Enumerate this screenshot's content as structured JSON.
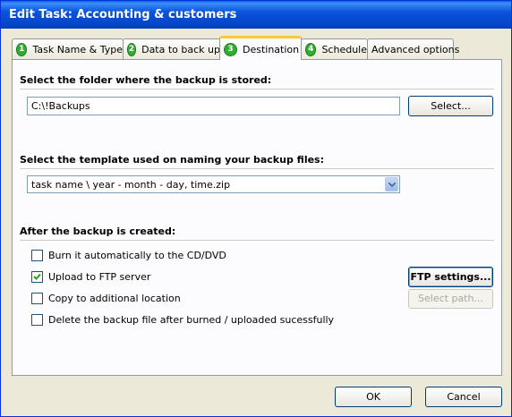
{
  "window": {
    "title": "Edit Task: Accounting & customers"
  },
  "tabs": [
    {
      "number": "1",
      "label": "Task Name & Type",
      "active": false
    },
    {
      "number": "2",
      "label": "Data to back up",
      "active": false
    },
    {
      "number": "3",
      "label": "Destination",
      "active": true
    },
    {
      "number": "4",
      "label": "Schedule",
      "active": false
    },
    {
      "number": "",
      "label": "Advanced options",
      "active": false
    }
  ],
  "folder": {
    "heading": "Select the folder where the backup is stored:",
    "path": "C:\\!Backups",
    "select_button": "Select..."
  },
  "template": {
    "heading": "Select the template used on naming your backup files:",
    "selected": "task name \\ year - month - day, time.zip"
  },
  "after": {
    "heading": "After the backup is created:",
    "options": [
      {
        "label": "Burn it automatically to the CD/DVD",
        "checked": false
      },
      {
        "label": "Upload to FTP server",
        "checked": true
      },
      {
        "label": "Copy to additional location",
        "checked": false
      },
      {
        "label": "Delete the backup file after burned / uploaded sucessfully",
        "checked": false
      }
    ],
    "ftp_button": "FTP settings...",
    "path_button": "Select path..."
  },
  "footer": {
    "ok": "OK",
    "cancel": "Cancel"
  },
  "colors": {
    "title_bar": "#0a53dc",
    "tab_highlight": "#ffc83c",
    "badge": "#2fae2f",
    "dialog_bg": "#ece9d8"
  }
}
